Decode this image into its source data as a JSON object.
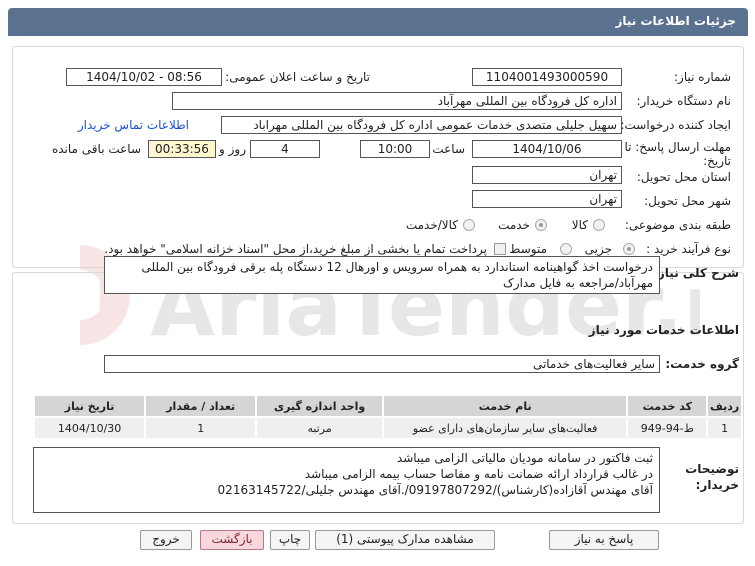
{
  "header": {
    "title": "جزئیات اطلاعات نیاز"
  },
  "fields": {
    "need_number_label": "شماره نیاز:",
    "need_number": "1104001493000590",
    "announce_label": "تاریخ و ساعت اعلان عمومی:",
    "announce_value": "1404/10/02 - 08:56",
    "buyer_org_label": "نام دستگاه خریدار:",
    "buyer_org": "اداره کل فرودگاه بین المللی مهرآباد",
    "creator_label": "ایجاد کننده درخواست:",
    "creator": "سهیل جلیلی متصدی خدمات عمومی اداره کل فرودگاه بین المللی مهراباد",
    "contact_link": "اطلاعات تماس خریدار",
    "deadline_label_1": "مهلت ارسال پاسخ: تا",
    "deadline_label_2": "تاریخ:",
    "deadline_date": "1404/10/06",
    "time_label": "ساعت",
    "deadline_time": "10:00",
    "days_value": "4",
    "days_label": "روز و",
    "remaining_time": "00:33:56",
    "remaining_label": "ساعت باقی مانده",
    "province_label": "استان محل تحویل:",
    "province": "تهران",
    "city_label": "شهر محل تحویل:",
    "city": "تهران",
    "category_label": "طبقه بندی موضوعی:",
    "category_options": [
      "کالا",
      "خدمت",
      "کالا/خدمت"
    ],
    "category_selected": "خدمت",
    "process_label": "نوع فرآیند خرید :",
    "process_options": [
      "جزیی",
      "متوسط"
    ],
    "payment_note": "پرداخت تمام یا بخشی از مبلغ خرید،از محل \"اسناد خزانه اسلامی\" خواهد بود."
  },
  "summary": {
    "label": "شرح کلی نیاز:",
    "text": "درخواست اخذ گواهینامه استاندارد به همراه سرویس و اورهال 12 دستگاه پله برقی فرودگاه بین المللی مهرآباد/مراجعه به فایل مدارک"
  },
  "services_section": {
    "title": "اطلاعات خدمات مورد نیاز",
    "group_label": "گروه خدمت:",
    "group_value": "سایر فعالیت‌های خدماتی"
  },
  "table": {
    "headers": [
      "ردیف",
      "کد خدمت",
      "نام خدمت",
      "واحد اندازه گیری",
      "تعداد / مقدار",
      "تاریخ نیاز"
    ],
    "rows": [
      [
        "1",
        "ط-94-949",
        "فعالیت‌های سایر سازمان‌های دارای عضو",
        "مرتبه",
        "1",
        "1404/10/30"
      ]
    ]
  },
  "notes": {
    "label_1": "توضیحات",
    "label_2": "خریدار:",
    "lines": [
      "ثبت فاکتور در سامانه مودیان مالیاتی الزامی میباشد",
      "در غالب قرارداد ارائه ضمانت نامه و مفاصا حساب بیمه الزامی میباشد",
      "آقای مهندس آقازاده(کارشناس)/09197807292/.آقای مهندس جلیلی/02163145722"
    ]
  },
  "buttons": {
    "reply": "پاسخ به نیاز",
    "attachments": "مشاهده مدارک پیوستی (1)",
    "print": "چاپ",
    "back": "بازگشت",
    "exit": "خروج"
  },
  "watermark": {
    "text": "AriaTender.net"
  },
  "colors": {
    "header_bg": "#5a7190",
    "link": "#1a53c8",
    "highlight": "#fef7cf",
    "pink_btn": "#f8d8dc"
  }
}
